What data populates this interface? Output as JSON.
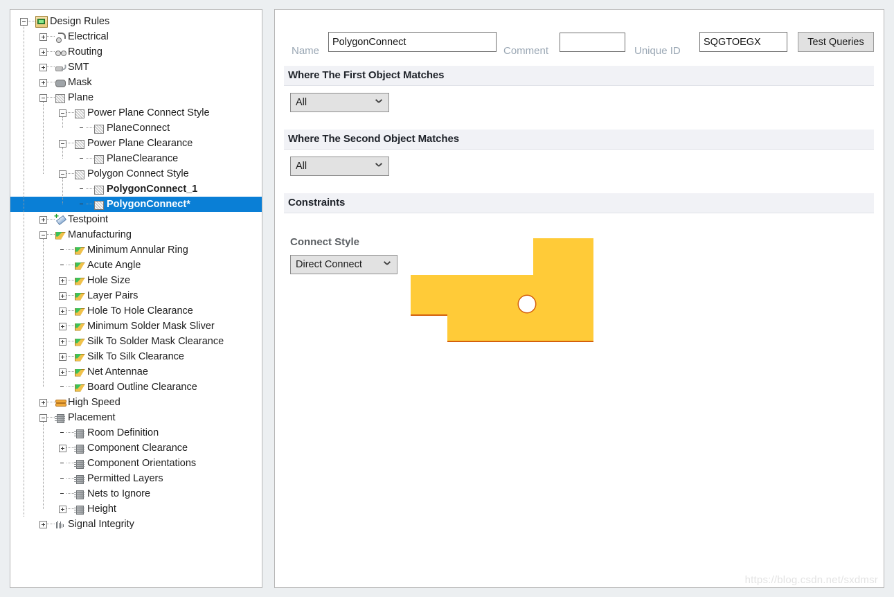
{
  "window": {
    "background_color": "#eceff1",
    "watermark": "https://blog.csdn.net/sxdmsr"
  },
  "tree": {
    "title": "Design Rules",
    "nodes": [
      {
        "label": "Design Rules",
        "depth": 0,
        "icon": "design-rules-folder-icon",
        "expander": "minus",
        "selected": false,
        "bold": false
      },
      {
        "label": "Electrical",
        "depth": 1,
        "icon": "electrical-icon",
        "expander": "plus",
        "selected": false,
        "bold": false
      },
      {
        "label": "Routing",
        "depth": 1,
        "icon": "routing-icon",
        "expander": "plus",
        "selected": false,
        "bold": false
      },
      {
        "label": "SMT",
        "depth": 1,
        "icon": "smt-icon",
        "expander": "plus",
        "selected": false,
        "bold": false
      },
      {
        "label": "Mask",
        "depth": 1,
        "icon": "mask-icon",
        "expander": "plus",
        "selected": false,
        "bold": false
      },
      {
        "label": "Plane",
        "depth": 1,
        "icon": "plane-icon",
        "expander": "minus",
        "selected": false,
        "bold": false
      },
      {
        "label": "Power Plane Connect Style",
        "depth": 2,
        "icon": "plane-icon",
        "expander": "minus",
        "selected": false,
        "bold": false
      },
      {
        "label": "PlaneConnect",
        "depth": 3,
        "icon": "plane-icon",
        "expander": "none",
        "selected": false,
        "bold": false
      },
      {
        "label": "Power Plane Clearance",
        "depth": 2,
        "icon": "plane-icon",
        "expander": "minus",
        "selected": false,
        "bold": false
      },
      {
        "label": "PlaneClearance",
        "depth": 3,
        "icon": "plane-icon",
        "expander": "none",
        "selected": false,
        "bold": false
      },
      {
        "label": "Polygon Connect Style",
        "depth": 2,
        "icon": "plane-icon",
        "expander": "minus",
        "selected": false,
        "bold": false
      },
      {
        "label": "PolygonConnect_1",
        "depth": 3,
        "icon": "plane-icon",
        "expander": "none",
        "selected": false,
        "bold": true
      },
      {
        "label": "PolygonConnect*",
        "depth": 3,
        "icon": "plane-icon",
        "expander": "none",
        "selected": true,
        "bold": true
      },
      {
        "label": "Testpoint",
        "depth": 1,
        "icon": "testpoint-icon",
        "expander": "plus",
        "selected": false,
        "bold": false
      },
      {
        "label": "Manufacturing",
        "depth": 1,
        "icon": "manufacturing-icon",
        "expander": "minus",
        "selected": false,
        "bold": false
      },
      {
        "label": "Minimum Annular Ring",
        "depth": 2,
        "icon": "manufacturing-icon",
        "expander": "none",
        "selected": false,
        "bold": false
      },
      {
        "label": "Acute Angle",
        "depth": 2,
        "icon": "manufacturing-icon",
        "expander": "none",
        "selected": false,
        "bold": false
      },
      {
        "label": "Hole Size",
        "depth": 2,
        "icon": "manufacturing-icon",
        "expander": "plus",
        "selected": false,
        "bold": false
      },
      {
        "label": "Layer Pairs",
        "depth": 2,
        "icon": "manufacturing-icon",
        "expander": "plus",
        "selected": false,
        "bold": false
      },
      {
        "label": "Hole To Hole Clearance",
        "depth": 2,
        "icon": "manufacturing-icon",
        "expander": "plus",
        "selected": false,
        "bold": false
      },
      {
        "label": "Minimum Solder Mask Sliver",
        "depth": 2,
        "icon": "manufacturing-icon",
        "expander": "plus",
        "selected": false,
        "bold": false
      },
      {
        "label": "Silk To Solder Mask Clearance",
        "depth": 2,
        "icon": "manufacturing-icon",
        "expander": "plus",
        "selected": false,
        "bold": false
      },
      {
        "label": "Silk To Silk Clearance",
        "depth": 2,
        "icon": "manufacturing-icon",
        "expander": "plus",
        "selected": false,
        "bold": false
      },
      {
        "label": "Net Antennae",
        "depth": 2,
        "icon": "manufacturing-icon",
        "expander": "plus",
        "selected": false,
        "bold": false
      },
      {
        "label": "Board Outline Clearance",
        "depth": 2,
        "icon": "manufacturing-icon",
        "expander": "none",
        "selected": false,
        "bold": false
      },
      {
        "label": "High Speed",
        "depth": 1,
        "icon": "high-speed-icon",
        "expander": "plus",
        "selected": false,
        "bold": false
      },
      {
        "label": "Placement",
        "depth": 1,
        "icon": "placement-icon",
        "expander": "minus",
        "selected": false,
        "bold": false
      },
      {
        "label": "Room Definition",
        "depth": 2,
        "icon": "placement-icon",
        "expander": "none",
        "selected": false,
        "bold": false
      },
      {
        "label": "Component Clearance",
        "depth": 2,
        "icon": "placement-icon",
        "expander": "plus",
        "selected": false,
        "bold": false
      },
      {
        "label": "Component Orientations",
        "depth": 2,
        "icon": "placement-icon",
        "expander": "none",
        "selected": false,
        "bold": false
      },
      {
        "label": "Permitted Layers",
        "depth": 2,
        "icon": "placement-icon",
        "expander": "none",
        "selected": false,
        "bold": false
      },
      {
        "label": "Nets to Ignore",
        "depth": 2,
        "icon": "placement-icon",
        "expander": "none",
        "selected": false,
        "bold": false
      },
      {
        "label": "Height",
        "depth": 2,
        "icon": "placement-icon",
        "expander": "plus",
        "selected": false,
        "bold": false
      },
      {
        "label": "Signal Integrity",
        "depth": 1,
        "icon": "signal-integrity-icon",
        "expander": "plus",
        "selected": false,
        "bold": false
      }
    ],
    "selection_color": "#0a7fd6"
  },
  "rule_editor": {
    "name_label": "Name",
    "name_value": "PolygonConnect",
    "comment_label": "Comment",
    "comment_value": "",
    "comment_placeholder": "",
    "unique_id_label": "Unique ID",
    "unique_id_value": "SQGTOEGX",
    "test_queries_button": "Test Queries",
    "sections": [
      {
        "title": "Where The First Object Matches",
        "scope_value": "All"
      },
      {
        "title": "Where The Second Object Matches",
        "scope_value": "All"
      },
      {
        "title": "Constraints"
      }
    ],
    "constraints": {
      "connect_style_label": "Connect Style",
      "connect_style_value": "Direct Connect",
      "preview": {
        "fill_color": "#ffcb38",
        "edge_color": "#d4600c",
        "hole_color": "#ffffff",
        "description": "polygon-direct-connect-preview"
      }
    }
  }
}
